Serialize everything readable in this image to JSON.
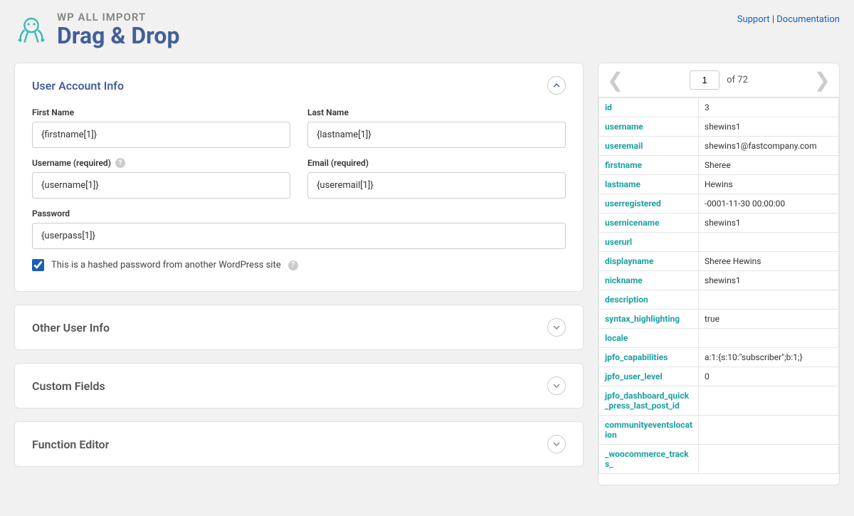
{
  "header": {
    "app_name": "WP ALL IMPORT",
    "page_title": "Drag & Drop",
    "support_link": "Support",
    "docs_link": "Documentation"
  },
  "account_panel": {
    "title": "User Account Info",
    "fields": {
      "firstname_label": "First Name",
      "firstname_value": "{firstname[1]}",
      "lastname_label": "Last Name",
      "lastname_value": "{lastname[1]}",
      "username_label": "Username (required)",
      "username_value": "{username[1]}",
      "email_label": "Email (required)",
      "email_value": "{useremail[1]}",
      "password_label": "Password",
      "password_value": "{userpass[1]}",
      "hashed_label": "This is a hashed password from another WordPress site"
    }
  },
  "other_panel": {
    "title": "Other User Info"
  },
  "custom_panel": {
    "title": "Custom Fields"
  },
  "function_panel": {
    "title": "Function Editor"
  },
  "records": {
    "current": "1",
    "total_prefix": "of",
    "total": "72",
    "rows": [
      {
        "key": "id",
        "val": "3"
      },
      {
        "key": "username",
        "val": "shewins1"
      },
      {
        "key": "useremail",
        "val": "shewins1@fastcompany.com"
      },
      {
        "key": "firstname",
        "val": "Sheree"
      },
      {
        "key": "lastname",
        "val": "Hewins"
      },
      {
        "key": "userregistered",
        "val": "-0001-11-30 00:00:00"
      },
      {
        "key": "usernicename",
        "val": "shewins1"
      },
      {
        "key": "userurl",
        "val": ""
      },
      {
        "key": "displayname",
        "val": "Sheree Hewins"
      },
      {
        "key": "nickname",
        "val": "shewins1"
      },
      {
        "key": "description",
        "val": ""
      },
      {
        "key": "syntax_highlighting",
        "val": "true"
      },
      {
        "key": "locale",
        "val": ""
      },
      {
        "key": "jpfo_capabilities",
        "val": "a:1:{s:10:\"subscriber\";b:1;}"
      },
      {
        "key": "jpfo_user_level",
        "val": "0"
      },
      {
        "key": "jpfo_dashboard_quick_press_last_post_id",
        "val": ""
      },
      {
        "key": "communityeventslocation",
        "val": ""
      },
      {
        "key": "_woocommerce_tracks_",
        "val": ""
      }
    ]
  }
}
